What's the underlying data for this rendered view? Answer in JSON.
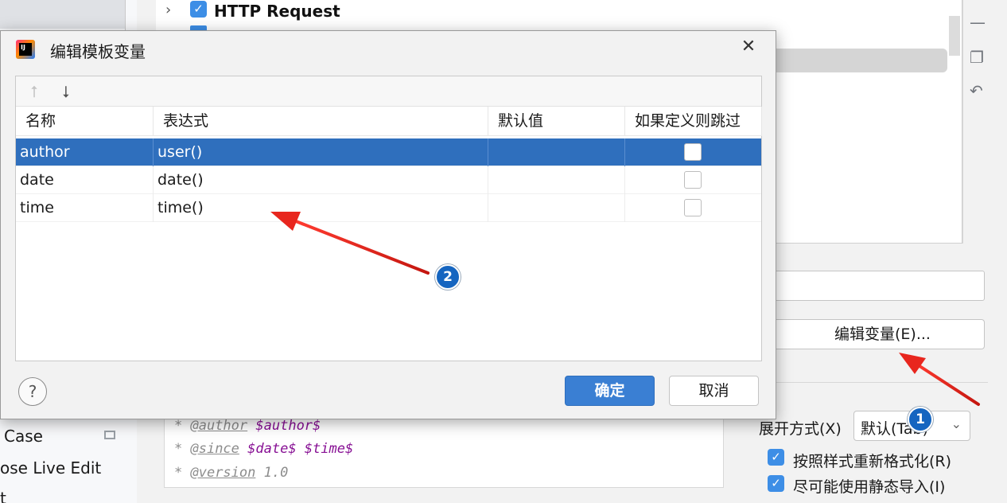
{
  "background": {
    "sidebar_items": [
      "Case",
      "ose Live Edit",
      "t"
    ],
    "tree_label": "HTTP Request",
    "edit_variables_button": "编辑变量(E)...",
    "expand_label": "展开方式(X)",
    "expand_value": "默认(Tab)",
    "reformat_label": "按照样式重新格式化(R)",
    "static_import_label": "尽可能使用静态导入(I)",
    "code": {
      "line1_tag": "@author",
      "line1_var": "$author$",
      "line2_tag": "@since",
      "line2_var": "$date$ $time$",
      "line3_tag": "@version",
      "line3_val": "1.0"
    }
  },
  "dialog": {
    "title": "编辑模板变量",
    "columns": [
      "名称",
      "表达式",
      "默认值",
      "如果定义则跳过"
    ],
    "rows": [
      {
        "name": "author",
        "expression": "user()",
        "default": "",
        "skip": false,
        "selected": true
      },
      {
        "name": "date",
        "expression": "date()",
        "default": "",
        "skip": false,
        "selected": false
      },
      {
        "name": "time",
        "expression": "time()",
        "default": "",
        "skip": false,
        "selected": false
      }
    ],
    "help_label": "?",
    "ok_label": "确定",
    "cancel_label": "取消"
  },
  "annotations": {
    "badge1": "1",
    "badge2": "2",
    "arrow_color": "#e8261e"
  },
  "colors": {
    "selection": "#2f6fbd",
    "primary_button": "#3a7fd3",
    "checkbox_checked": "#3d8ee6"
  }
}
